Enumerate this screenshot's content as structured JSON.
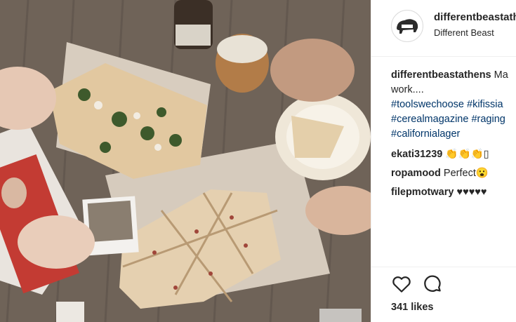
{
  "post": {
    "username": "differentbeastathens",
    "display_name": "Different Beast",
    "caption_text": "Ma work....",
    "caption_line1": "Ma",
    "caption_line2": "work....",
    "hashtags": [
      "#toolswechoose #kifissia",
      "#cerealmagazine #raging",
      "#californialager"
    ],
    "comments": [
      {
        "user": "ekati31239",
        "text": "👏👏👏▯"
      },
      {
        "user": "ropamood",
        "text": "Perfect😮"
      },
      {
        "user": "filepmotwary",
        "text": "♥♥♥♥♥"
      }
    ],
    "likes": "341 likes",
    "icons": {
      "like": "heart-icon",
      "comment": "comment-icon"
    }
  }
}
